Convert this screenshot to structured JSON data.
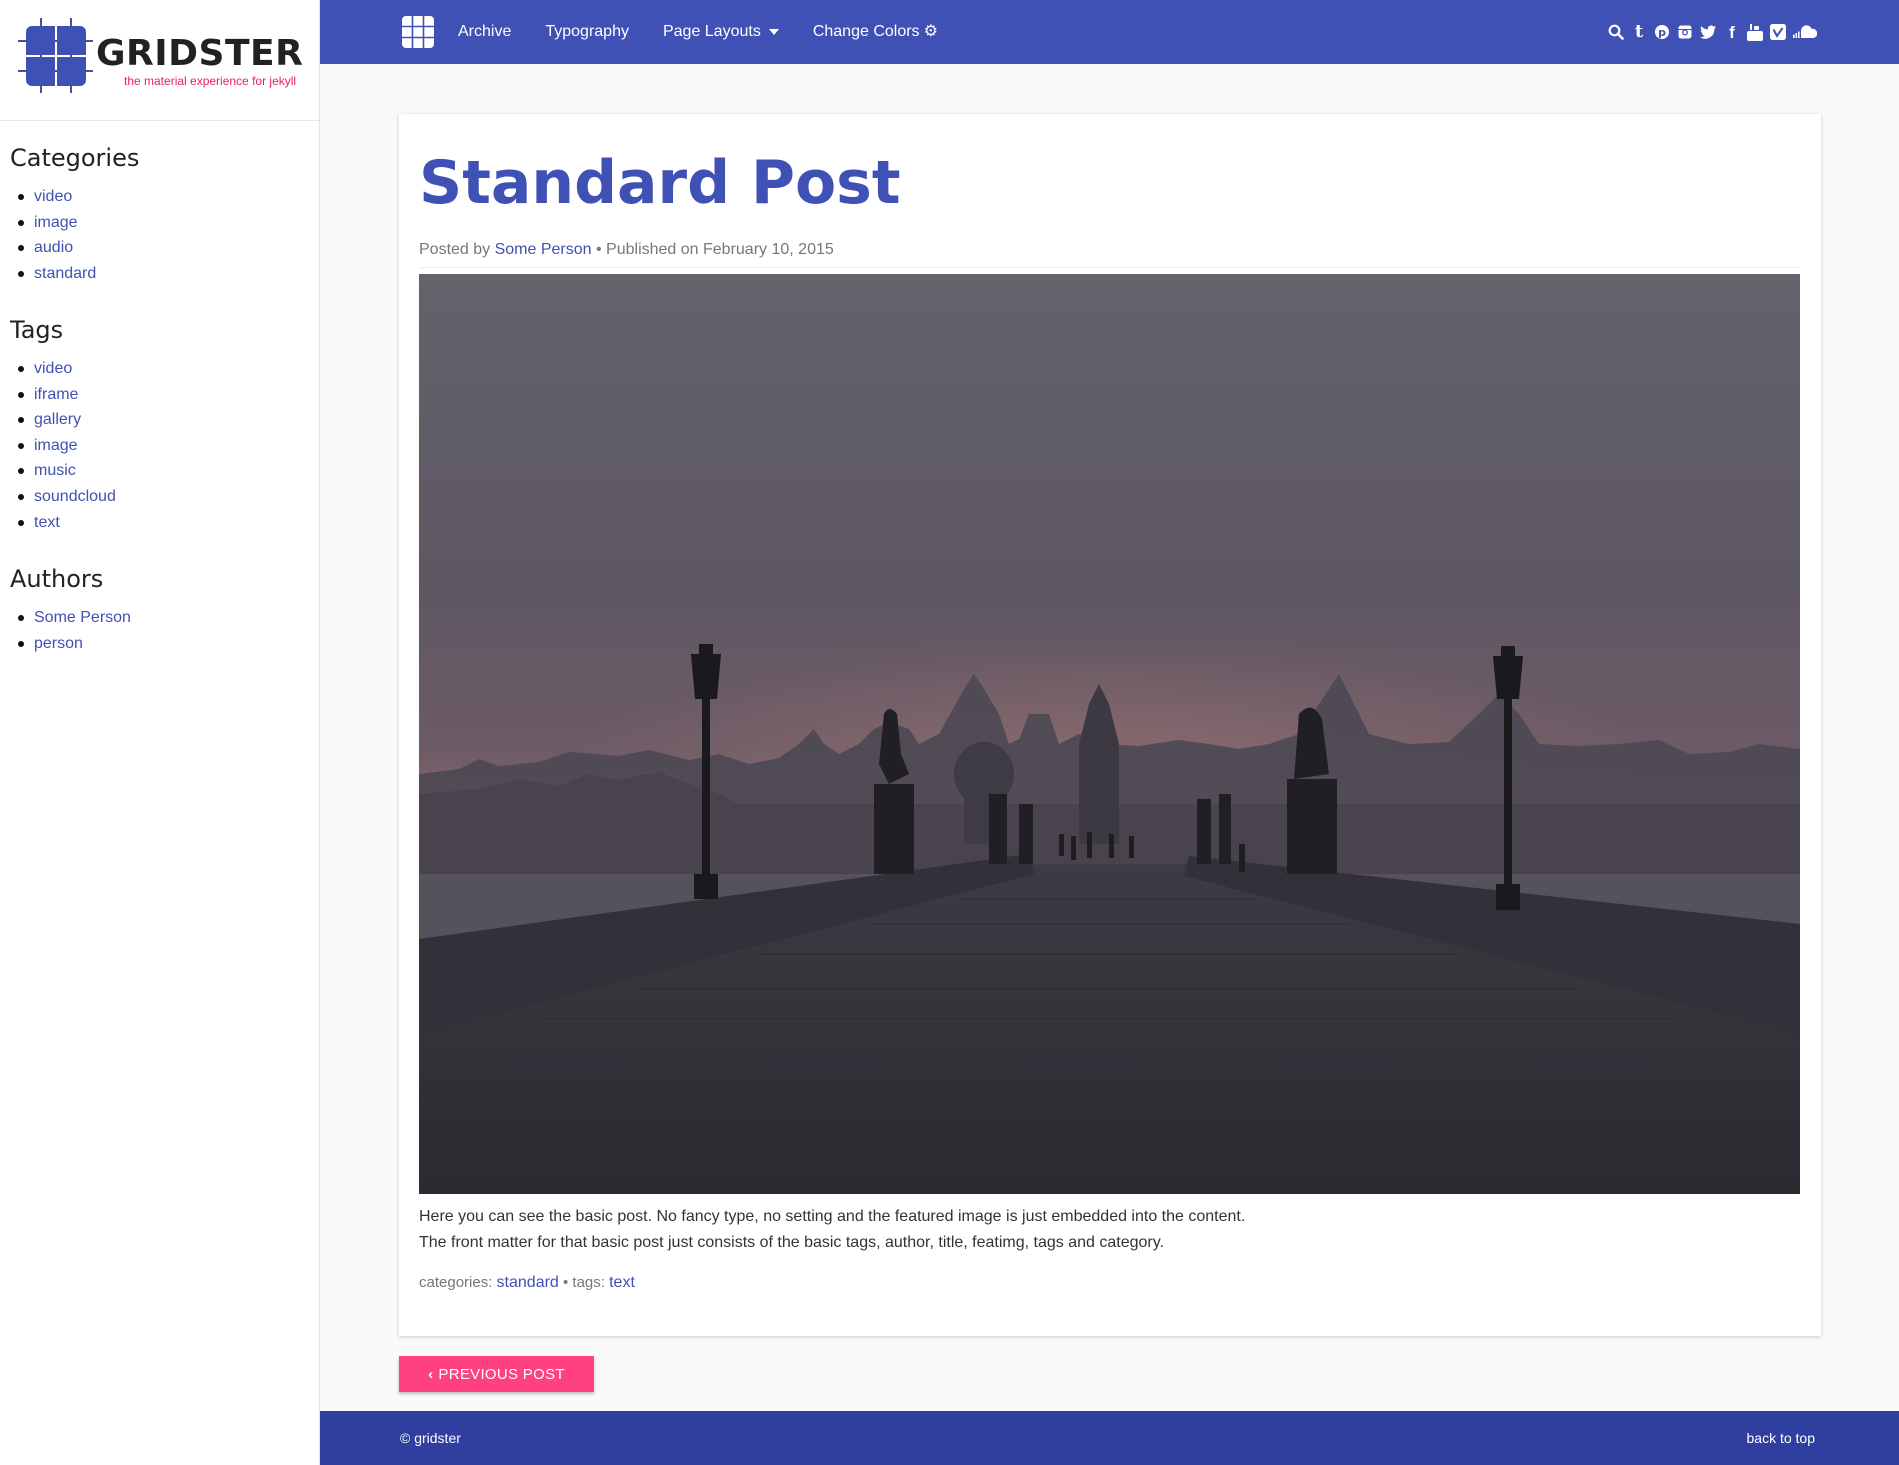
{
  "brand": {
    "name": "GRIDSTER",
    "tagline": "the material experience for jekyll"
  },
  "nav": {
    "archive": "Archive",
    "typography": "Typography",
    "page_layouts": "Page Layouts",
    "change_colors": "Change Colors"
  },
  "social_icons": [
    "search-icon",
    "tumblr-icon",
    "pinterest-icon",
    "instagram-icon",
    "twitter-icon",
    "facebook-icon",
    "youtube-icon",
    "vimeo-icon",
    "soundcloud-icon"
  ],
  "sidebar": {
    "categories_heading": "Categories",
    "categories": [
      "video",
      "image",
      "audio",
      "standard"
    ],
    "tags_heading": "Tags",
    "tags": [
      "video",
      "iframe",
      "gallery",
      "image",
      "music",
      "soundcloud",
      "text"
    ],
    "authors_heading": "Authors",
    "authors": [
      "Some Person",
      "person"
    ]
  },
  "post": {
    "title": "Standard Post",
    "posted_by": "Posted by",
    "author": "Some Person",
    "published": "• Published on February 10, 2015",
    "body_line1": "Here you can see the basic post. No fancy type, no setting and the featured image is just embedded into the content.",
    "body_line2": "The front matter for that basic post just consists of the basic tags, author, title, featimg, tags and category.",
    "categories_label": "categories:",
    "category": "standard",
    "tags_label": "• tags:",
    "tag": "text"
  },
  "prev_button": "PREVIOUS POST",
  "footer": {
    "copyright": "© gridster",
    "back_to_top": "back to top"
  },
  "colors": {
    "primary": "#3f51b5",
    "primary_dark": "#303f9f",
    "accent": "#ff4081",
    "tagline": "#e91e63"
  }
}
